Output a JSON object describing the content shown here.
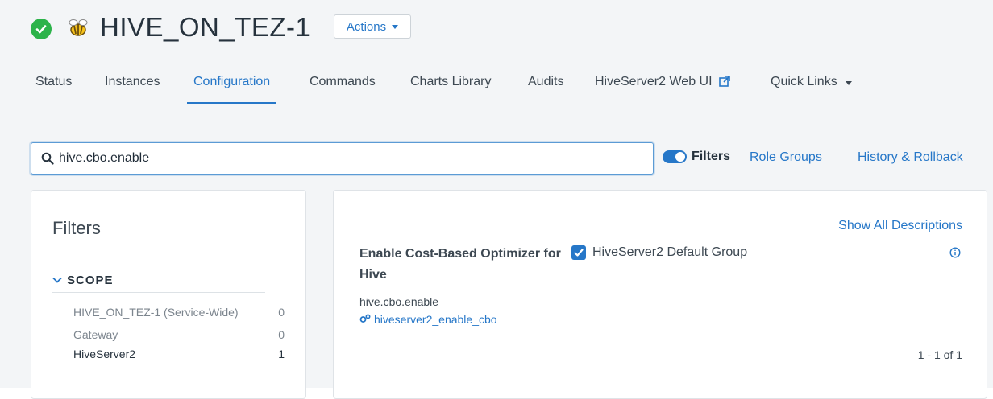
{
  "header": {
    "service_name": "HIVE_ON_TEZ-1",
    "actions_label": "Actions"
  },
  "tabs": [
    {
      "label": "Status"
    },
    {
      "label": "Instances"
    },
    {
      "label": "Configuration"
    },
    {
      "label": "Commands"
    },
    {
      "label": "Charts Library"
    },
    {
      "label": "Audits"
    },
    {
      "label": "HiveServer2 Web UI"
    },
    {
      "label": "Quick Links"
    }
  ],
  "active_tab": "Configuration",
  "search": {
    "value": "hive.cbo.enable",
    "placeholder": ""
  },
  "toolbar": {
    "filters_label": "Filters",
    "role_groups_label": "Role Groups",
    "history_label": "History & Rollback"
  },
  "filters_panel": {
    "title": "Filters",
    "scope_label": "SCOPE",
    "scope_items": [
      {
        "label": "HIVE_ON_TEZ-1 (Service-Wide)",
        "count": "0"
      },
      {
        "label": "Gateway",
        "count": "0"
      },
      {
        "label": "HiveServer2",
        "count": "1"
      }
    ]
  },
  "config": {
    "show_all_descriptions": "Show All Descriptions",
    "label": "Enable Cost-Based Optimizer for Hive",
    "key": "hive.cbo.enable",
    "param": "hiveserver2_enable_cbo",
    "group_label": "HiveServer2 Default Group",
    "group_checked": true,
    "pagination": "1 - 1 of 1"
  },
  "colors": {
    "accent": "#2677c8",
    "status_ok": "#2cb34a"
  }
}
